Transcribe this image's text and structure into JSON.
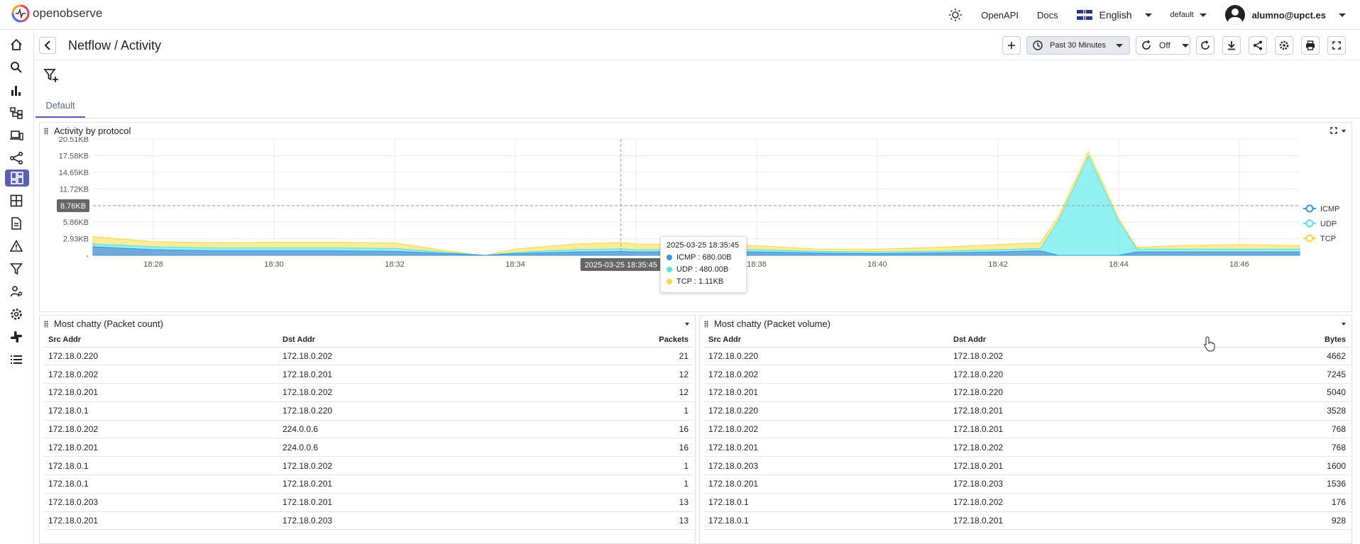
{
  "app": {
    "logo_text": "openobserve",
    "colors": {
      "accent": "#5960b2",
      "icmp": "#5b9bd5",
      "udp": "#7ff0f0",
      "tcp": "#f8e27a"
    }
  },
  "header": {
    "openapi_label": "OpenAPI",
    "docs_label": "Docs",
    "language_label": "English",
    "org_label": "default",
    "user_label": "alumno@upct.es"
  },
  "dashboard": {
    "title": "Netflow / Activity",
    "time_range_label": "Past 30 Minutes",
    "refresh_label": "Off",
    "tab_label": "Default"
  },
  "chart_panel": {
    "title": "Activity by protocol",
    "crosshair_label": "8.76KB",
    "x_pointer_label": "2025-03-25 18:35:45",
    "tooltip": {
      "time": "2025-03-25 18:35:45",
      "icmp": "ICMP : 680.00B",
      "udp": "UDP : 480.00B",
      "tcp": "TCP : 1.11KB"
    }
  },
  "chart_data": {
    "type": "area",
    "stacked": true,
    "y_tick_labels": [
      "-",
      "2.93KB",
      "5.86KB",
      "8.79KB",
      "11.72KB",
      "14.65KB",
      "17.58KB",
      "20.51KB"
    ],
    "x_tick_labels": [
      "18:28",
      "18:30",
      "18:32",
      "18:34",
      "18:36",
      "18:38",
      "18:40",
      "18:42",
      "18:44",
      "18:46"
    ],
    "ylim": [
      0,
      20.51
    ],
    "y_unit": "KB",
    "legend": [
      "ICMP",
      "UDP",
      "TCP"
    ],
    "legend_position": "right",
    "x": [
      "18:27",
      "18:28",
      "18:29",
      "18:30",
      "18:31",
      "18:32",
      "18:32.9",
      "18:33.5",
      "18:34",
      "18:35",
      "18:35.75",
      "18:36",
      "18:37",
      "18:38",
      "18:39",
      "18:40",
      "18:41",
      "18:42",
      "18:42.7",
      "18:43",
      "18:43.5",
      "18:44",
      "18:44.3",
      "18:45",
      "18:46",
      "18:47"
    ],
    "series": [
      {
        "name": "ICMP",
        "values": [
          1.5,
          1.0,
          0.8,
          0.8,
          0.8,
          0.7,
          0.3,
          0.0,
          0.3,
          0.6,
          0.68,
          0.6,
          0.6,
          0.6,
          0.4,
          0.3,
          0.4,
          0.6,
          0.8,
          0.0,
          0.0,
          0.0,
          0.6,
          0.6,
          0.6,
          0.6
        ]
      },
      {
        "name": "UDP",
        "values": [
          0.5,
          0.5,
          0.5,
          0.5,
          0.5,
          0.5,
          0.2,
          0.0,
          0.2,
          0.4,
          0.48,
          0.4,
          0.4,
          0.4,
          0.3,
          0.3,
          0.3,
          0.4,
          0.4,
          6.0,
          17.5,
          6.0,
          0.5,
          0.5,
          0.5,
          0.5
        ]
      },
      {
        "name": "TCP",
        "values": [
          1.3,
          0.9,
          0.9,
          1.0,
          1.0,
          1.0,
          0.2,
          0.0,
          0.6,
          1.0,
          1.11,
          1.0,
          0.9,
          0.7,
          0.4,
          0.5,
          0.7,
          0.9,
          1.0,
          0.8,
          0.8,
          0.5,
          0.3,
          0.6,
          0.8,
          0.6
        ]
      }
    ]
  },
  "table_packets": {
    "title": "Most chatty (Packet count)",
    "headers": [
      "Src Addr",
      "Dst Addr",
      "Packets"
    ],
    "rows": [
      [
        "172.18.0.220",
        "172.18.0.202",
        "21"
      ],
      [
        "172.18.0.202",
        "172.18.0.201",
        "12"
      ],
      [
        "172.18.0.201",
        "172.18.0.202",
        "12"
      ],
      [
        "172.18.0.1",
        "172.18.0.220",
        "1"
      ],
      [
        "172.18.0.202",
        "224.0.0.6",
        "16"
      ],
      [
        "172.18.0.201",
        "224.0.0.6",
        "16"
      ],
      [
        "172.18.0.1",
        "172.18.0.202",
        "1"
      ],
      [
        "172.18.0.1",
        "172.18.0.201",
        "1"
      ],
      [
        "172.18.0.203",
        "172.18.0.201",
        "13"
      ],
      [
        "172.18.0.201",
        "172.18.0.203",
        "13"
      ]
    ]
  },
  "table_volume": {
    "title": "Most chatty (Packet volume)",
    "headers": [
      "Src Addr",
      "Dst Addr",
      "Bytes"
    ],
    "rows": [
      [
        "172.18.0.220",
        "172.18.0.202",
        "4662"
      ],
      [
        "172.18.0.202",
        "172.18.0.220",
        "7245"
      ],
      [
        "172.18.0.201",
        "172.18.0.220",
        "5040"
      ],
      [
        "172.18.0.220",
        "172.18.0.201",
        "3528"
      ],
      [
        "172.18.0.202",
        "172.18.0.201",
        "768"
      ],
      [
        "172.18.0.201",
        "172.18.0.202",
        "768"
      ],
      [
        "172.18.0.203",
        "172.18.0.201",
        "1600"
      ],
      [
        "172.18.0.201",
        "172.18.0.203",
        "1536"
      ],
      [
        "172.18.0.1",
        "172.18.0.202",
        "176"
      ],
      [
        "172.18.0.1",
        "172.18.0.201",
        "928"
      ]
    ]
  }
}
